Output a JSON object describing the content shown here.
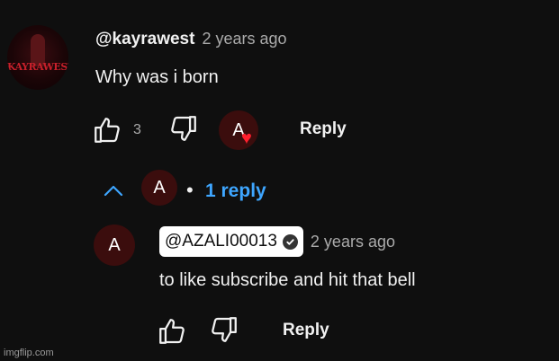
{
  "comment": {
    "author": "@kayrawest",
    "avatar_wordmark": "KAYRAWEST",
    "timestamp": "2 years ago",
    "text": "Why was i born",
    "like_count": "3",
    "hearted_by_initial": "A",
    "reply_label": "Reply"
  },
  "replies_toggle": {
    "avatar_initial": "A",
    "separator": "•",
    "label": "1 reply"
  },
  "reply": {
    "avatar_initial": "A",
    "author": "@AZALI00013",
    "timestamp": "2 years ago",
    "text": "to like subscribe and hit that bell",
    "reply_label": "Reply"
  },
  "watermark": "imgflip.com",
  "colors": {
    "background": "#0f0f0f",
    "link": "#3ea6ff",
    "heart": "#ff1f2d",
    "avatar_bg": "#3b0d0d"
  }
}
